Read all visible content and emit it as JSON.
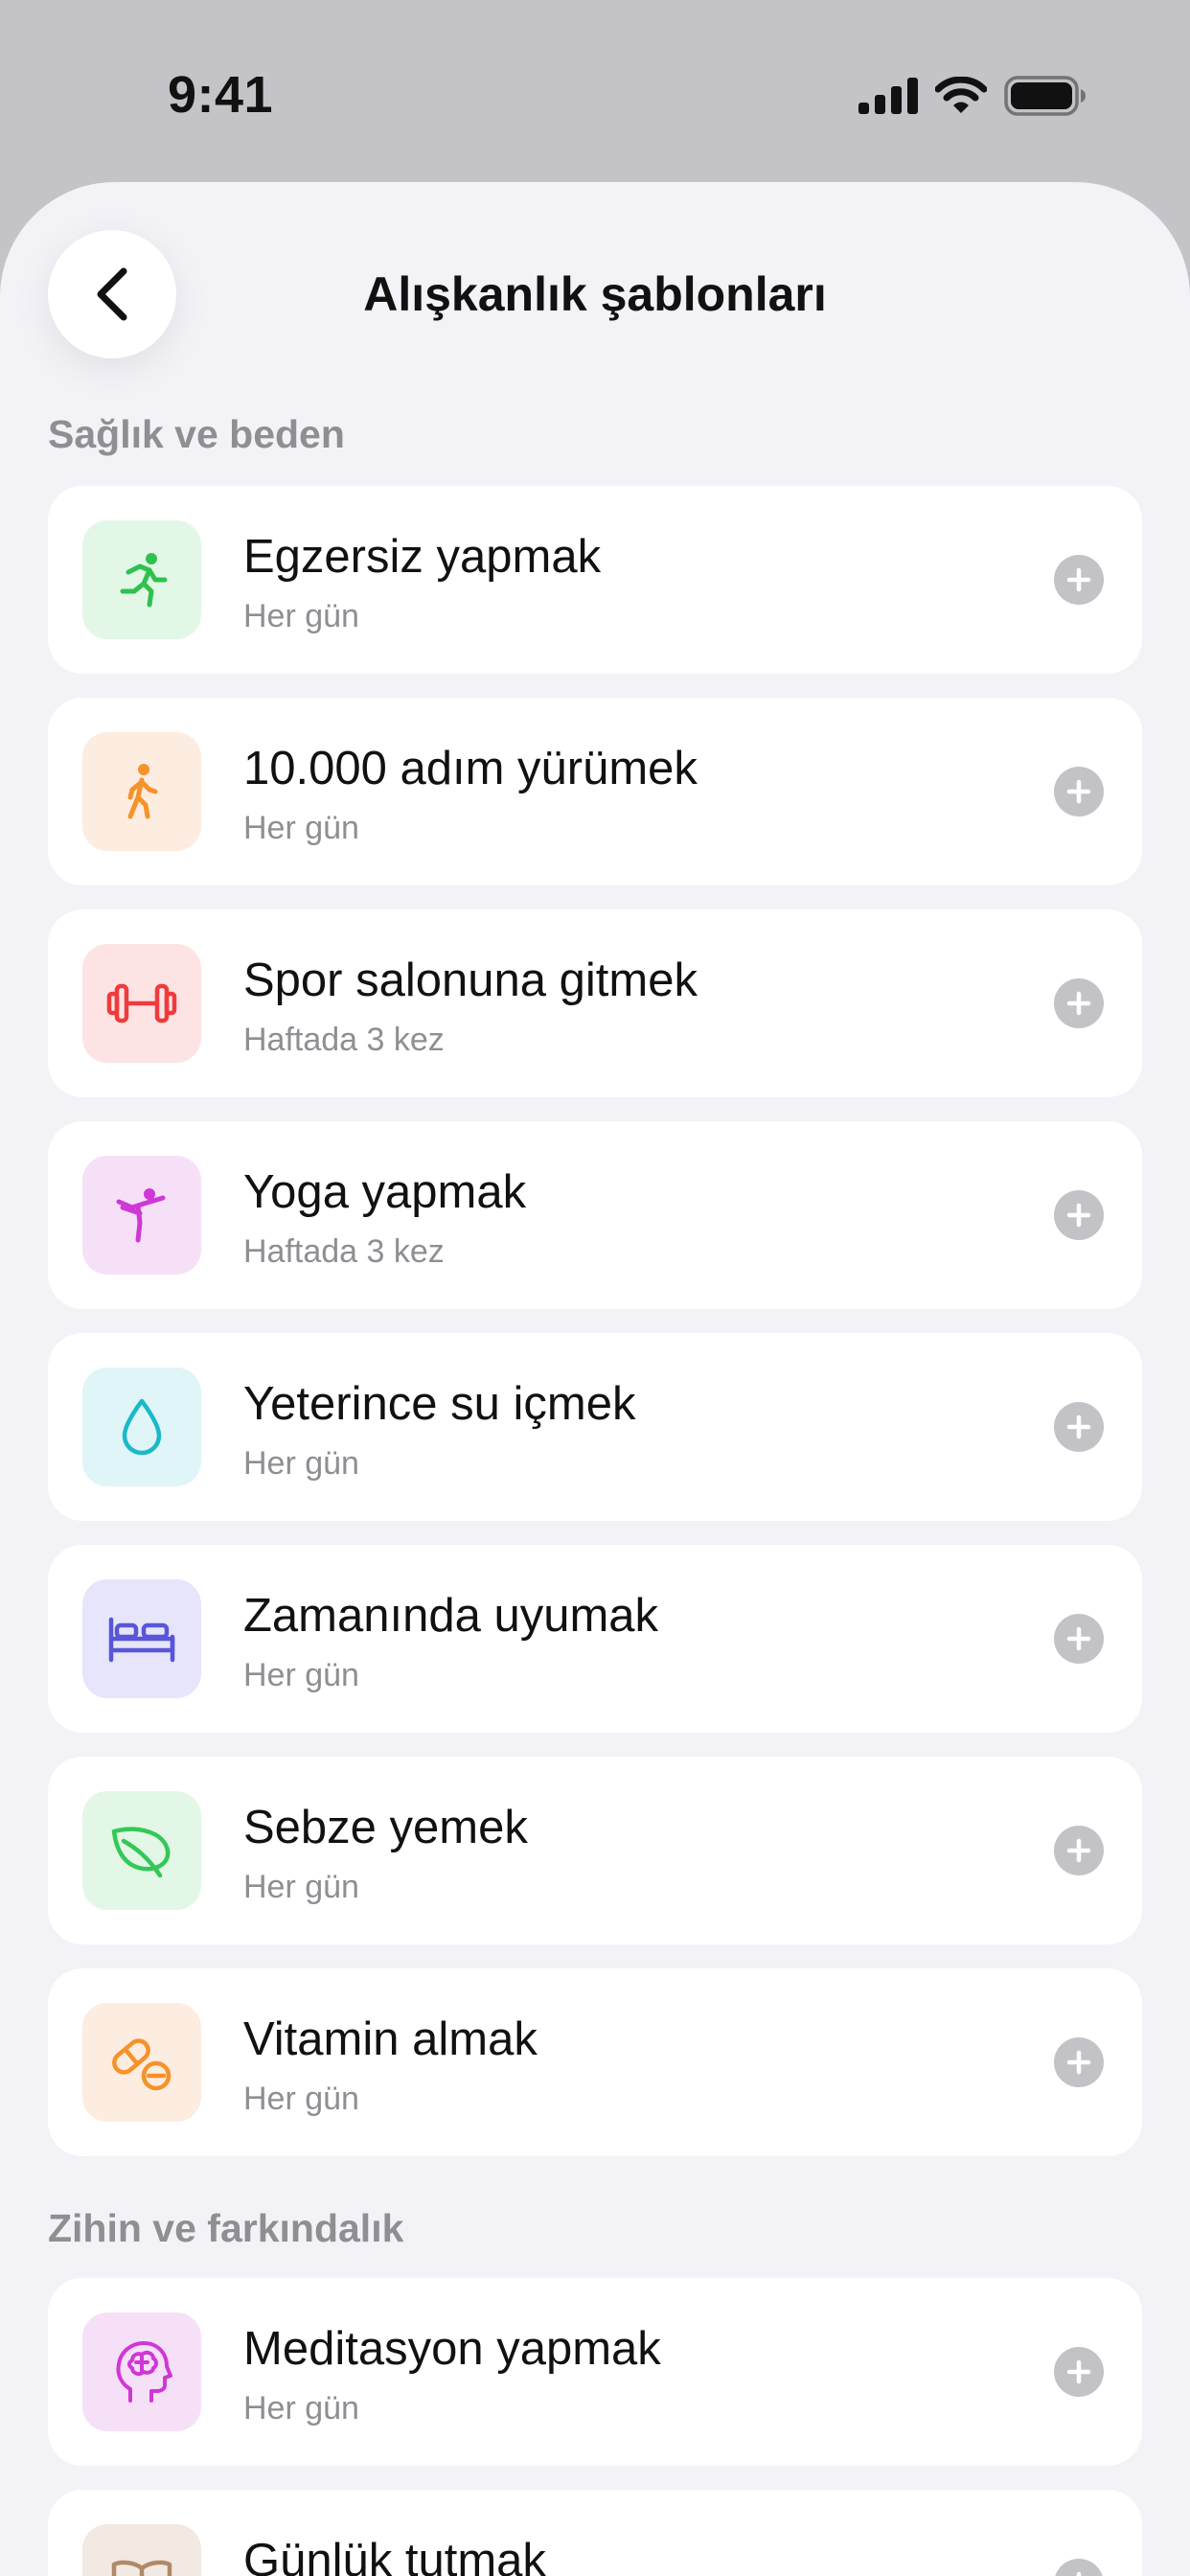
{
  "status_bar": {
    "time": "9:41"
  },
  "nav": {
    "title": "Alışkanlık şablonları"
  },
  "sections": {
    "health": "Sağlık ve beden",
    "mind": "Zihin ve farkındalık"
  },
  "items": [
    {
      "title": "Egzersiz yapmak",
      "subtitle": "Her gün",
      "icon": "running-icon",
      "tint": "#e3f7e6",
      "color": "#2fc14f"
    },
    {
      "title": "10.000 adım yürümek",
      "subtitle": "Her gün",
      "icon": "walking-icon",
      "tint": "#fdece0",
      "color": "#f5922a"
    },
    {
      "title": "Spor salonuna gitmek",
      "subtitle": "Haftada 3 kez",
      "icon": "dumbbell-icon",
      "tint": "#fde3e3",
      "color": "#ef3b3b"
    },
    {
      "title": "Yoga yapmak",
      "subtitle": "Haftada 3 kez",
      "icon": "yoga-icon",
      "tint": "#f6e0f8",
      "color": "#cf37d6"
    },
    {
      "title": "Yeterince su içmek",
      "subtitle": "Her gün",
      "icon": "water-drop-icon",
      "tint": "#dff5f8",
      "color": "#19b9c9"
    },
    {
      "title": "Zamanında uyumak",
      "subtitle": "Her gün",
      "icon": "bed-icon",
      "tint": "#e6e5fb",
      "color": "#5856d6"
    },
    {
      "title": "Sebze yemek",
      "subtitle": "Her gün",
      "icon": "leaf-icon",
      "tint": "#e3f7e6",
      "color": "#34c759"
    },
    {
      "title": "Vitamin almak",
      "subtitle": "Her gün",
      "icon": "pill-icon",
      "tint": "#fdece0",
      "color": "#f5922a"
    },
    {
      "title": "Meditasyon yapmak",
      "subtitle": "Her gün",
      "icon": "brain-head-icon",
      "tint": "#f6e0f8",
      "color": "#cf37d6"
    },
    {
      "title": "Günlük tutmak",
      "subtitle": "",
      "icon": "journal-icon",
      "tint": "#f1e9e2",
      "color": "#b08968"
    }
  ]
}
